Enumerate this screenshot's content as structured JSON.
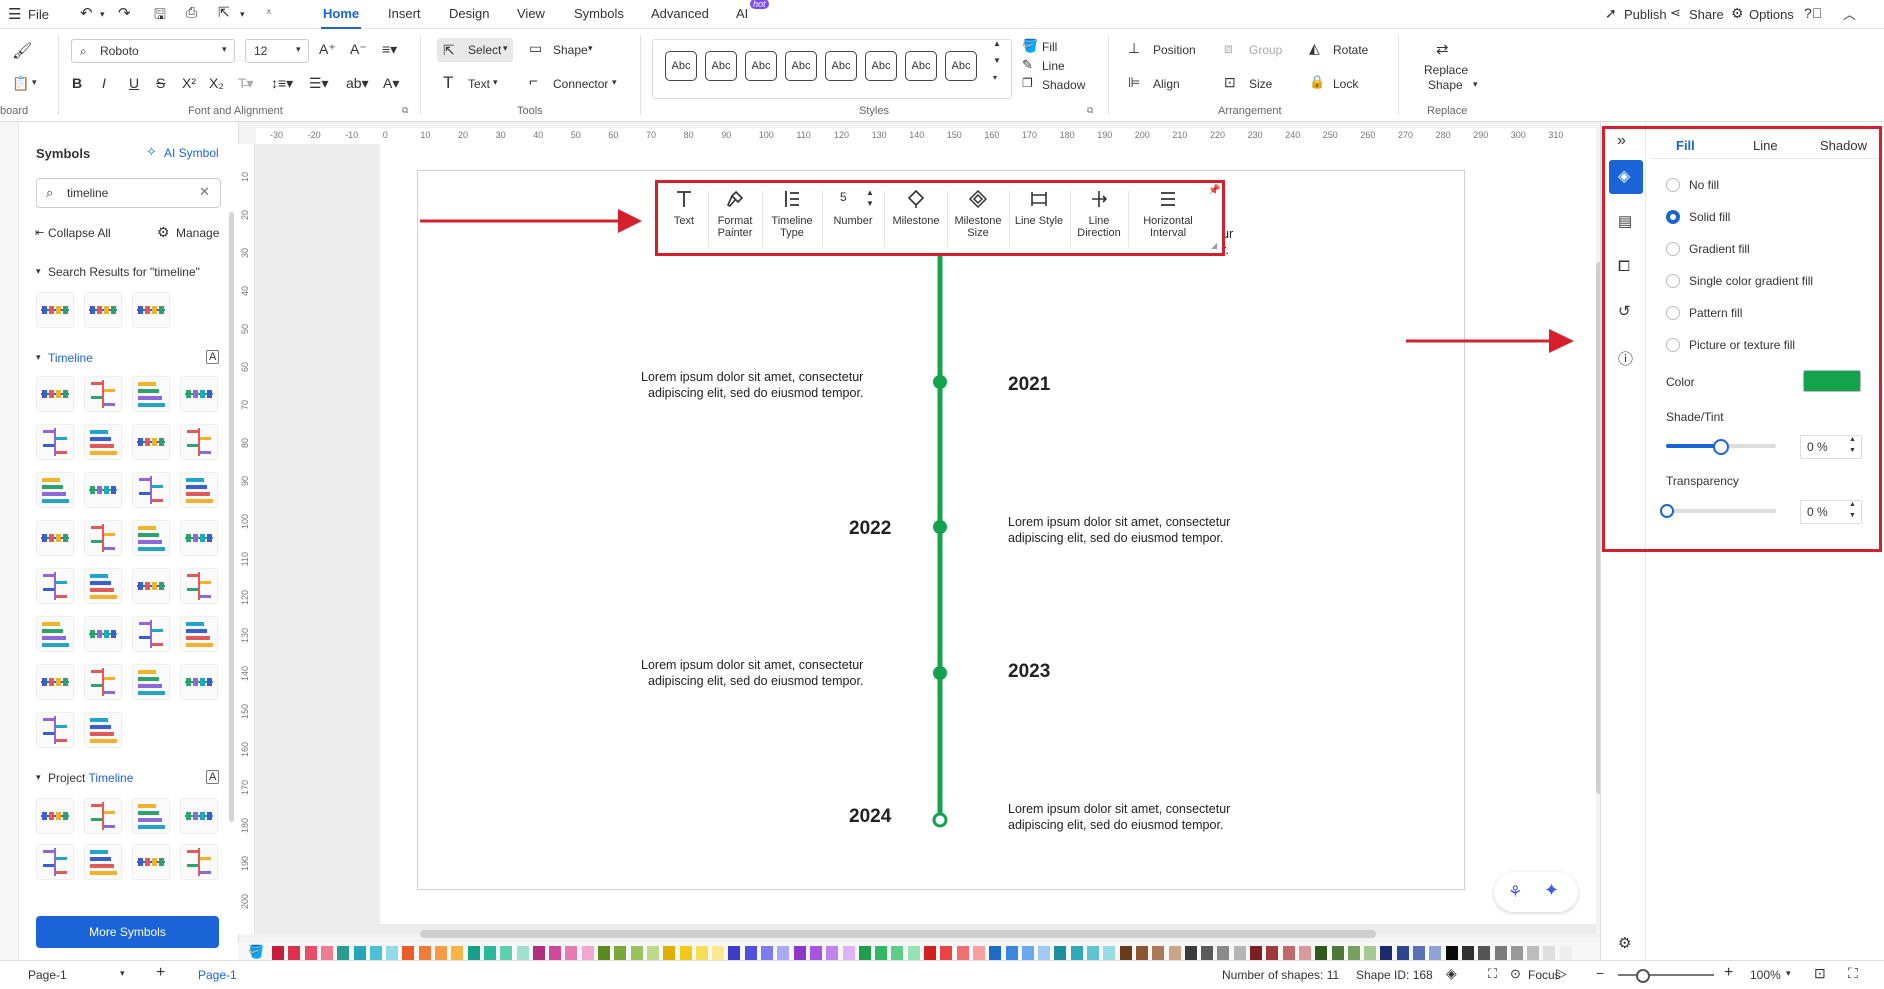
{
  "menu": {
    "file": "File",
    "tabs": [
      "Home",
      "Insert",
      "Design",
      "View",
      "Symbols",
      "Advanced",
      "AI"
    ],
    "hot_badge": "hot",
    "publish": "Publish",
    "share": "Share",
    "options": "Options"
  },
  "ribbon": {
    "font_name": "Roboto",
    "font_size": "12",
    "select": "Select",
    "shape": "Shape",
    "text": "Text",
    "connector": "Connector",
    "style_btn": "Abc",
    "fill": "Fill",
    "line": "Line",
    "shadow": "Shadow",
    "position": "Position",
    "group": "Group",
    "rotate": "Rotate",
    "align": "Align",
    "size": "Size",
    "lock": "Lock",
    "replace_shape_1": "Replace",
    "replace_shape_2": "Shape",
    "groups": {
      "clipboard": "board",
      "font": "Font and Alignment",
      "tools": "Tools",
      "styles": "Styles",
      "arrangement": "Arrangement",
      "replace": "Replace"
    }
  },
  "left": {
    "title": "Symbols",
    "ai_symbol": "AI Symbol",
    "search_value": "timeline",
    "collapse_all": "Collapse All",
    "manage": "Manage",
    "search_results": "Search Results for  \"timeline\"",
    "section_timeline": "Timeline",
    "section_project_prefix": "Project ",
    "section_project_suffix": "Timeline",
    "more_symbols": "More Symbols"
  },
  "ruler": {
    "h": [
      "-30",
      "-20",
      "-10",
      "0",
      "10",
      "20",
      "30",
      "40",
      "50",
      "60",
      "70",
      "80",
      "90",
      "100",
      "110",
      "120",
      "130",
      "140",
      "150",
      "160",
      "170",
      "180",
      "190",
      "200",
      "210",
      "220",
      "230",
      "240",
      "250",
      "260",
      "270",
      "280",
      "290",
      "300",
      "310"
    ],
    "v": [
      "10",
      "20",
      "30",
      "40",
      "50",
      "60",
      "70",
      "80",
      "90",
      "100",
      "110",
      "120",
      "130",
      "140",
      "150",
      "160",
      "170",
      "180",
      "190",
      "200"
    ]
  },
  "floating_toolbar": {
    "items": [
      {
        "l1": "Text",
        "l2": ""
      },
      {
        "l1": "Format",
        "l2": "Painter"
      },
      {
        "l1": "Timeline",
        "l2": "Type"
      },
      {
        "l1": "Number",
        "l2": ""
      },
      {
        "l1": "Milestone",
        "l2": ""
      },
      {
        "l1": "Milestone",
        "l2": "Size"
      },
      {
        "l1": "Line Style",
        "l2": ""
      },
      {
        "l1": "Line",
        "l2": "Direction"
      },
      {
        "l1": "Horizontal",
        "l2": "Interval"
      }
    ],
    "number_value": "5"
  },
  "timeline": {
    "line_color": "#13a34d",
    "years": [
      "2021",
      "2022",
      "2023",
      "2024"
    ],
    "lorem_1": "Lorem ipsum dolor sit amet, consectetur",
    "lorem_2": "adipiscing elit, sed do eiusmod tempor.",
    "partial_text": "ur",
    "partial_text2": "r."
  },
  "right": {
    "tabs": [
      "Fill",
      "Line",
      "Shadow"
    ],
    "options": [
      "No fill",
      "Solid fill",
      "Gradient fill",
      "Single color gradient fill",
      "Pattern fill",
      "Picture or texture fill"
    ],
    "selected": 1,
    "color_label": "Color",
    "color_value": "#13a34d",
    "shade_label": "Shade/Tint",
    "shade_value": "0 %",
    "shade_level": 0.5,
    "transparency_label": "Transparency",
    "transparency_value": "0 %",
    "transparency_level": 0
  },
  "status": {
    "page_select": "Page-1",
    "page_tab": "Page-1",
    "shapes": "Number of shapes: 11",
    "shape_id": "Shape ID: 168",
    "focus": "Focus",
    "zoom": "100%"
  },
  "palette": [
    "#c41e3a",
    "#d9324a",
    "#e84e6a",
    "#f07c92",
    "#2a9d8f",
    "#26a6b8",
    "#4dc0d6",
    "#8fd9e8",
    "#e85d2a",
    "#f27a3a",
    "#f59a45",
    "#f7b545",
    "#14a085",
    "#2bb89a",
    "#5ed0b0",
    "#9fe0cf",
    "#b03080",
    "#d04a9a",
    "#e57ab5",
    "#f1a7cf",
    "#5a8a1e",
    "#78a83a",
    "#98c35a",
    "#bdd98a",
    "#e0b000",
    "#f2c81a",
    "#f7dc55",
    "#fbe990",
    "#3c3cc8",
    "#5050e0",
    "#7c7cf0",
    "#a9a9f6",
    "#8f35c8",
    "#a855e0",
    "#c184ef",
    "#dbb3f6",
    "#1f9e4e",
    "#30b865",
    "#5cce88",
    "#97e2b2",
    "#d02020",
    "#e84444",
    "#f07070",
    "#f6a0a0",
    "#1e6ac8",
    "#3a86e0",
    "#6aa8ee",
    "#a2c9f6",
    "#1a8fa0",
    "#2faabd",
    "#5cc4d3",
    "#97dbe5",
    "#6a3a1a",
    "#8a5530",
    "#a97a55",
    "#cba585",
    "#3a3a3a",
    "#5a5a5a",
    "#8a8a8a",
    "#b5b5b5",
    "#7a2020",
    "#a03a3a",
    "#c06a6a",
    "#d89a9a",
    "#2e5a1e",
    "#4a7a35",
    "#75a05e",
    "#a6c893",
    "#1a2a6a",
    "#2d4690",
    "#5872b8",
    "#8fa3d6",
    "#0a0a0a",
    "#303030",
    "#555555",
    "#7a7a7a",
    "#9a9a9a",
    "#bdbdbd",
    "#dedede",
    "#eeeeee"
  ]
}
